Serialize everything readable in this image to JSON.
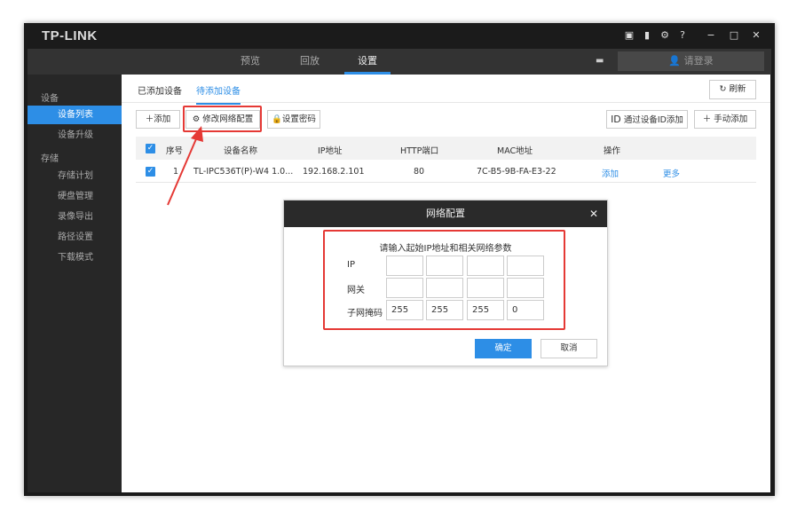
{
  "app": {
    "logo": "TP-LINK",
    "window_controls": [
      "−",
      "□",
      "✕"
    ]
  },
  "nav": {
    "tabs": [
      "预览",
      "回放",
      "设置"
    ],
    "active": 2,
    "login": "请登录"
  },
  "sidebar": {
    "groups": [
      {
        "label": "设备",
        "items": [
          "设备列表",
          "设备升级"
        ]
      },
      {
        "label": "存储",
        "items": [
          "存储计划",
          "硬盘管理",
          "录像导出",
          "路径设置",
          "下载模式"
        ]
      }
    ],
    "active_item": "设备列表"
  },
  "tabs": {
    "added": "已添加设备",
    "pending": "待添加设备",
    "refresh": "刷新"
  },
  "toolbar": {
    "add": "添加",
    "modify_network": "修改网络配置",
    "set_password": "设置密码",
    "add_by_id": "通过设备ID添加",
    "id_badge": "ID",
    "manual_add": "手动添加"
  },
  "table": {
    "headers": [
      "序号",
      "设备名称",
      "IP地址",
      "HTTP端口",
      "MAC地址",
      "操作"
    ],
    "rows": [
      {
        "index": "1",
        "name": "TL-IPC536T(P)-W4 1.0...",
        "ip": "192.168.2.101",
        "port": "80",
        "mac": "7C-B5-9B-FA-E3-22",
        "action_add": "添加",
        "action_more": "更多"
      }
    ]
  },
  "dialog": {
    "title": "网络配置",
    "prompt": "请输入起始IP地址和相关网络参数",
    "ip_label": "IP",
    "gateway_label": "网关",
    "mask_label": "子网掩码",
    "ip": [
      "",
      "",
      "",
      ""
    ],
    "gateway": [
      "",
      "",
      "",
      ""
    ],
    "mask": [
      "255",
      "255",
      "255",
      "0"
    ],
    "ok": "确定",
    "cancel": "取消"
  },
  "colors": {
    "accent": "#2d8ee6",
    "highlight": "#e53935"
  }
}
